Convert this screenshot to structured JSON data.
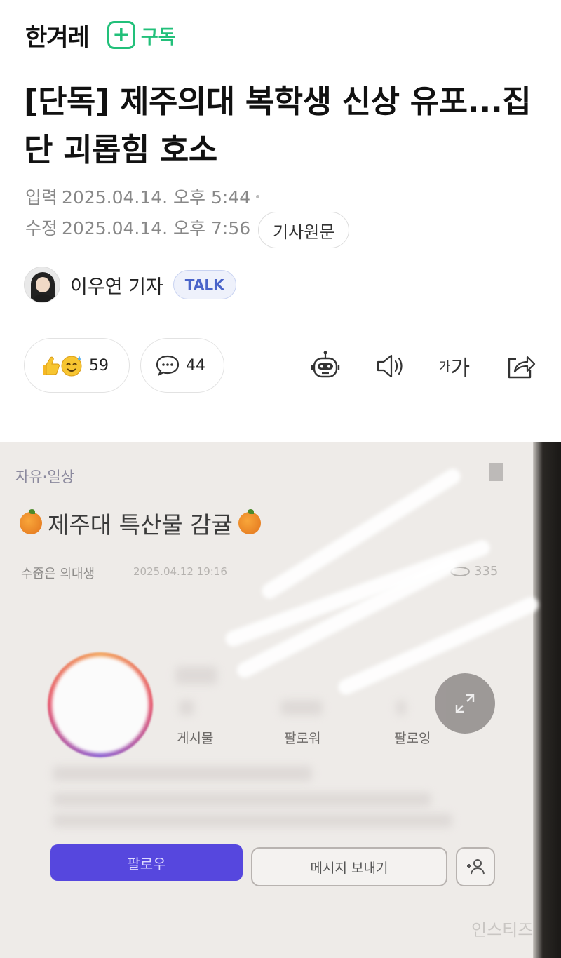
{
  "header": {
    "logo": "한겨레",
    "subscribe_icon_glyph": "+",
    "subscribe_label": "구독",
    "accent_color": "#22c07a"
  },
  "article": {
    "headline": "[단독] 제주의대 복학생 신상 유포...집단 괴롭힘 호소",
    "input_label": "입력",
    "input_time": "2025.04.14. 오후 5:44",
    "update_label": "수정",
    "update_time": "2025.04.14. 오후 7:56",
    "original_button": "기사원문"
  },
  "author": {
    "name": "이우연 기자",
    "talk_label": "TALK"
  },
  "actions": {
    "reaction_count": "59",
    "comment_count": "44",
    "font_small_glyph": "가",
    "font_large_glyph": "가",
    "tools": [
      "robot-icon",
      "speaker-icon",
      "font-size-icon",
      "share-icon"
    ]
  },
  "photo": {
    "category": "자유·일상",
    "post_title": "제주대 특산물 감귤",
    "nickname": "수줍은 의대생",
    "post_date": "2025.04.12 19:16",
    "views": "335",
    "stats_labels": [
      "게시물",
      "팔로워",
      "팔로잉"
    ],
    "follow_button": "팔로우",
    "message_button": "메시지 보내기",
    "watermark": "인스티즈"
  }
}
